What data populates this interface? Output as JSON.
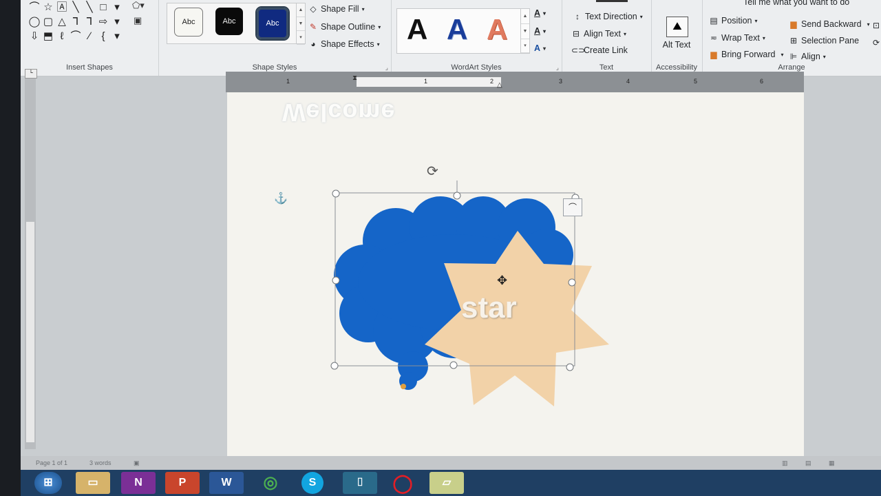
{
  "ribbon": {
    "groups": {
      "insert_shapes": "Insert Shapes",
      "shape_styles": "Shape Styles",
      "wordart_styles": "WordArt Styles",
      "text": "Text",
      "accessibility": "Accessibility",
      "arrange": "Arrange"
    },
    "shape_glyphs": [
      "⌒",
      "☆",
      "🄰",
      "╲",
      "╲",
      "□",
      "⬜",
      "◯",
      "▢",
      "△",
      "⅂",
      "⅂",
      "⇨",
      "⬒",
      "⇩",
      "⌓",
      "ℓ",
      "∕",
      "⌒",
      "{",
      "▾"
    ],
    "style_swatches": [
      "Abc",
      "Abc",
      "Abc"
    ],
    "shape_fill": "Shape Fill",
    "shape_outline": "Shape Outline",
    "shape_effects": "Shape Effects",
    "wordart_letters": [
      "A",
      "A",
      "A"
    ],
    "text_direction": "Text Direction",
    "align_text": "Align Text",
    "create_link": "Create Link",
    "alt_text": "Alt Text",
    "position": "Position",
    "wrap_text": "Wrap Text",
    "bring_forward": "Bring Forward",
    "send_backward": "Send Backward",
    "selection_pane": "Selection Pane",
    "align": "Align",
    "tell_me": "Tell me what you want to do"
  },
  "ruler_numbers": [
    "1",
    "1",
    "2",
    "3",
    "4",
    "5",
    "6"
  ],
  "document": {
    "welcome_text": "Welcome",
    "star_text": "star"
  },
  "colors": {
    "cloud": "#1565c8",
    "star": "#f2d2a8",
    "ribbon": "#eceef0",
    "taskbar": "#1f3f63"
  },
  "status": {
    "page": "Page 1 of 1",
    "words": "3 words"
  },
  "taskbar_apps": [
    "windows-start",
    "file-explorer",
    "onenote",
    "powerpoint",
    "word",
    "chrome",
    "skype",
    "app",
    "opera",
    "sticky-notes"
  ]
}
